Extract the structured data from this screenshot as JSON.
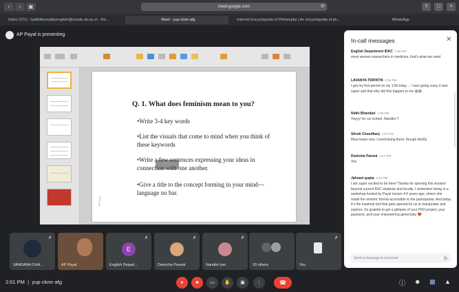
{
  "browser": {
    "url": "meet.google.com",
    "tabs": [
      "Inbox (371) - lastbitbereadbyenglish@zonalc.du.ac.in - Re...",
      "Meet - yup-ckmr-afg",
      "Internet Encyclopedia of Philosophy | An encyclopedia of ph...",
      "WhatsApp"
    ]
  },
  "presenter": {
    "label": "AP Payal is presenting"
  },
  "slide": {
    "title": "Q. 1. What does feminism mean to you?",
    "bullets": [
      "Write 3-4 key words",
      "List the visuals that come to mind when you think of these keywords",
      "Write a few sentences expressing your ideas in connection with one another.",
      "Give a title to the concept forming in your mind— language no bar."
    ],
    "side_label": "AP Payal"
  },
  "chat": {
    "title": "In-call messages",
    "messages": [
      {
        "name": "English Department IDKC",
        "time": "1:56 PM",
        "text": "more women researchers in medicine, that's what we need"
      },
      {
        "name": "LAVANYA TRIPATHI",
        "time": "1:56 PM",
        "text": "I got my first period on my 12th bday ... I was going crazy it was super sad that why did this happen to me 😅😅"
      },
      {
        "name": "Nidhi Bhandari",
        "time": "1:59 PM",
        "text": "Yayyy! for sci school, Nandini !!"
      },
      {
        "name": "Shruti Choudhary",
        "time": "1:57 PM",
        "text": "Must leave now. Loved being there, though briefly."
      },
      {
        "name": "Deeksha Pareek",
        "time": "1:57 PM",
        "text": "Yes"
      },
      {
        "name": "Jahnavi gupta",
        "time": "2:01 PM",
        "text": "I am super excited to be here! Thanks for opening this session beyond current IIDC students and faculty. I remember being in a workshop hosted by Payal ma'am 4-5 years ago, where she made the women' format accessible to the participants. And today it's the maximal tool that gets opened for us to manipulate and explore. So grateful to get a glimpse of your PhD project, your passions, and your empowering generosity ❤️"
      }
    ],
    "input_placeholder": "Send a message to everyone"
  },
  "participants": [
    {
      "name": "VANDANA CHA...",
      "kind": "photo-dark"
    },
    {
      "name": "AP Payal",
      "kind": "video"
    },
    {
      "name": "English Depart...",
      "kind": "letter",
      "letter": "E",
      "color": "#8e44ad"
    },
    {
      "name": "Deeksha Pareek",
      "kind": "avatar-peach"
    },
    {
      "name": "Nandini Iyer",
      "kind": "avatar-pink"
    },
    {
      "name": "20 others",
      "kind": "others"
    },
    {
      "name": "You",
      "kind": "you"
    }
  ],
  "meeting": {
    "time": "2:01 PM",
    "code": "yup-ckmr-afg"
  },
  "controls": {
    "mic_icon": "mic-off-icon",
    "cam_icon": "cam-off-icon",
    "captions_icon": "captions-icon",
    "hand_icon": "raise-hand-icon",
    "present_icon": "present-icon",
    "more_icon": "more-icon",
    "hangup_icon": "hangup-icon"
  },
  "colors": {
    "accent_red": "#ea4335",
    "chat_bg": "#ffffff",
    "meet_bg": "#202124",
    "active_blue": "#8ab4f8"
  }
}
